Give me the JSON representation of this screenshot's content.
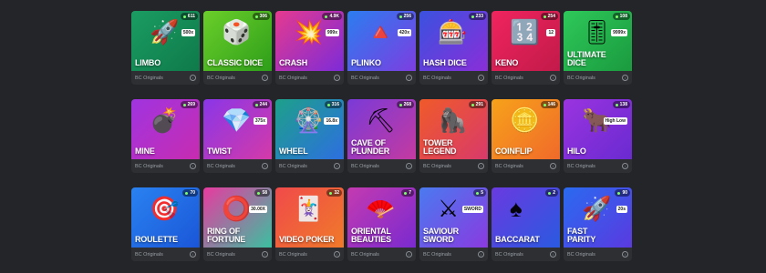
{
  "cards": [
    {
      "title": "Limbo",
      "players": "611",
      "provider": "BC Originals",
      "bg": "linear-gradient(135deg,#1a9c62,#0f7a4a)",
      "icon": "rocket-icon",
      "glyph": "🚀",
      "badge": "500x"
    },
    {
      "title": "Classic Dice",
      "players": "306",
      "provider": "BC Originals",
      "bg": "linear-gradient(135deg,#6bcf2a,#2e9e1a)",
      "icon": "dice-icon",
      "glyph": "🎲",
      "badge": ""
    },
    {
      "title": "Crash",
      "players": "4.9K",
      "provider": "BC Originals",
      "bg": "linear-gradient(135deg,#e53a8f,#7d2bd8)",
      "icon": "starburst-icon",
      "glyph": "💥",
      "badge": "999x"
    },
    {
      "title": "Plinko",
      "players": "256",
      "provider": "BC Originals",
      "bg": "linear-gradient(135deg,#2b7df0,#7c3ee0)",
      "icon": "plinko-pyramid-icon",
      "glyph": "🔺",
      "badge": "420x"
    },
    {
      "title": "Hash Dice",
      "players": "233",
      "provider": "BC Originals",
      "bg": "linear-gradient(135deg,#3a52e0,#8a2ed8)",
      "icon": "slot-dice-icon",
      "glyph": "🎰",
      "badge": ""
    },
    {
      "title": "Keno",
      "players": "254",
      "provider": "BC Originals",
      "bg": "linear-gradient(135deg,#f0245e,#c21a4a)",
      "icon": "keno-tile-icon",
      "glyph": "🔢",
      "badge": "12"
    },
    {
      "title": "Ultimate\nDice",
      "players": "108",
      "provider": "BC Originals",
      "bg": "linear-gradient(135deg,#2ec85a,#1a9a3e)",
      "icon": "slider-icon",
      "glyph": "🎚",
      "badge": "9999x"
    },
    {
      "title": "Mine",
      "players": "269",
      "provider": "BC Originals",
      "bg": "linear-gradient(135deg,#a034e0,#c72cb0)",
      "icon": "bomb-icon",
      "glyph": "💣",
      "badge": ""
    },
    {
      "title": "Twist",
      "players": "244",
      "provider": "BC Originals",
      "bg": "linear-gradient(135deg,#8a36e8,#d43aa8)",
      "icon": "diamond-icon",
      "glyph": "💎",
      "badge": "375x"
    },
    {
      "title": "Wheel",
      "players": "316",
      "provider": "BC Originals",
      "bg": "linear-gradient(135deg,#1da08a,#2d6fe0)",
      "icon": "wheel-icon",
      "glyph": "🎡",
      "badge": "16.8x"
    },
    {
      "title": "Cave of\nPlunder",
      "players": "268",
      "provider": "BC Originals",
      "bg": "linear-gradient(135deg,#7a3ad8,#c43aa0)",
      "icon": "pickaxe-icon",
      "glyph": "⛏",
      "badge": ""
    },
    {
      "title": "Tower\nLegend",
      "players": "291",
      "provider": "BC Originals",
      "bg": "linear-gradient(135deg,#f05a2a,#d83a6a)",
      "icon": "gorilla-icon",
      "glyph": "🦍",
      "badge": ""
    },
    {
      "title": "Coinflip",
      "players": "146",
      "provider": "BC Originals",
      "bg": "linear-gradient(135deg,#f7a21a,#f06a2a)",
      "icon": "coin-icon",
      "glyph": "🪙",
      "badge": ""
    },
    {
      "title": "Hilo",
      "players": "138",
      "provider": "BC Originals",
      "bg": "linear-gradient(135deg,#9a34e0,#6a2ad0)",
      "icon": "bull-icon",
      "glyph": "🐂",
      "badge": "High Low"
    },
    {
      "title": "Roulette",
      "players": "70",
      "provider": "BC Originals",
      "bg": "linear-gradient(135deg,#2a82f0,#1a56d8)",
      "icon": "roulette-wheel-icon",
      "glyph": "🎯",
      "badge": ""
    },
    {
      "title": "Ring of\nFortune",
      "players": "58",
      "provider": "BC Originals",
      "bg": "linear-gradient(135deg,#e83aa0,#3ac0a0)",
      "icon": "ring-icon",
      "glyph": "⭕",
      "badge": "30.00X"
    },
    {
      "title": "Video Poker",
      "players": "32",
      "provider": "BC Originals",
      "bg": "linear-gradient(135deg,#f04a4a,#f07a2a)",
      "icon": "playing-cards-icon",
      "glyph": "🃏",
      "badge": ""
    },
    {
      "title": "Oriental\nBeauties",
      "players": "7",
      "provider": "BC Originals",
      "bg": "linear-gradient(135deg,#c43ab0,#7a2ad0)",
      "icon": "fan-icon",
      "glyph": "🪭",
      "badge": ""
    },
    {
      "title": "Saviour\nSword",
      "players": "5",
      "provider": "BC Originals",
      "bg": "linear-gradient(135deg,#4a7af0,#8a3ae0)",
      "icon": "sword-icon",
      "glyph": "⚔",
      "badge": "SWORD"
    },
    {
      "title": "Baccarat",
      "players": "2",
      "provider": "BC Originals",
      "bg": "linear-gradient(135deg,#6a3ae0,#2a5ae0)",
      "icon": "spade-card-icon",
      "glyph": "♠",
      "badge": ""
    },
    {
      "title": "Fast\nParity",
      "players": "90",
      "provider": "BC Originals",
      "bg": "linear-gradient(135deg,#2a6af0,#5a3ae0)",
      "icon": "rocket-icon",
      "glyph": "🚀",
      "badge": "20s"
    }
  ]
}
